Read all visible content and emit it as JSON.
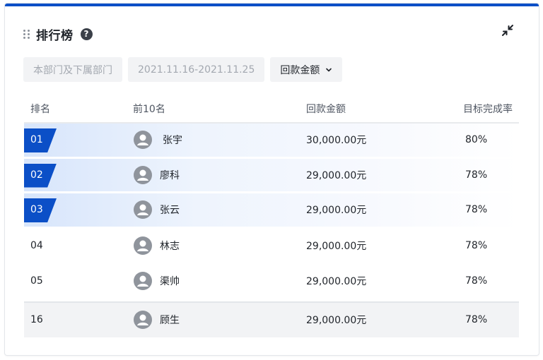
{
  "header": {
    "title": "排行榜",
    "help_icon": "question-circle-icon",
    "collapse_icon": "collapse-arrows-icon"
  },
  "filters": [
    {
      "label": "本部门及下属部门",
      "active": false
    },
    {
      "label": "2021.11.16-2021.11.25",
      "active": false
    },
    {
      "label": "回款金额",
      "active": true,
      "icon": "chevron-down-icon"
    }
  ],
  "table": {
    "columns": [
      "排名",
      "前10名",
      "回款金额",
      "目标完成率"
    ],
    "rows": [
      {
        "rank": "01",
        "name": "张宇",
        "amount": "30,000.00元",
        "rate": "80%"
      },
      {
        "rank": "02",
        "name": "廖科",
        "amount": "29,000.00元",
        "rate": "78%"
      },
      {
        "rank": "03",
        "name": "张云",
        "amount": "29,000.00元",
        "rate": "78%"
      },
      {
        "rank": "04",
        "name": "林志",
        "amount": "29,000.00元",
        "rate": "78%"
      },
      {
        "rank": "05",
        "name": "渠帅",
        "amount": "29,000.00元",
        "rate": "78%"
      }
    ],
    "current_user_row": {
      "rank": "16",
      "name": "顾生",
      "amount": "29,000.00元",
      "rate": "78%"
    }
  },
  "colors": {
    "accent": "#0b4fc7",
    "highlight_gradient_start": "#d7e5fb",
    "current_row_bg": "#f2f3f5"
  }
}
